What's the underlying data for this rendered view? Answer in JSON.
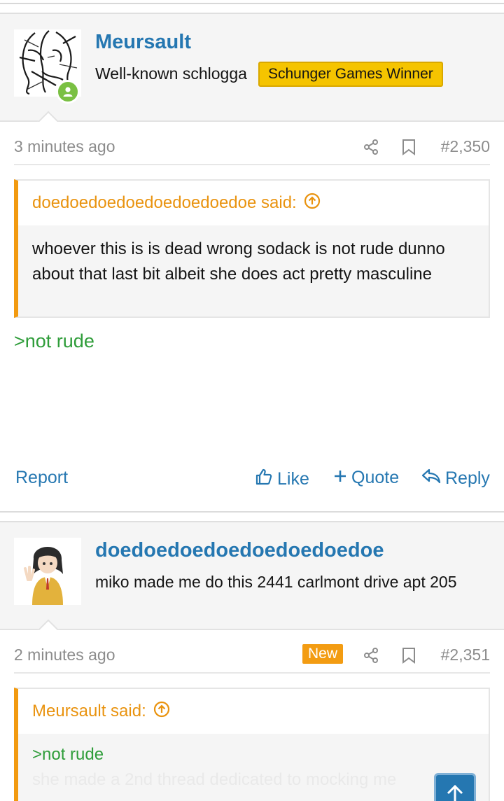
{
  "post1": {
    "username": "Meursault",
    "user_title": "Well-known schlogga",
    "banner": "Schunger Games Winner",
    "time": "3 minutes ago",
    "post_number": "#2,350",
    "quote_author": "doedoedoedoedoedoedoedoe said:",
    "quote_text": "whoever this is is dead wrong sodack is not rude dunno about that last bit albeit she does act pretty masculine",
    "reply_greentext": ">not rude",
    "actions": {
      "report": "Report",
      "like": "Like",
      "quote": "Quote",
      "reply": "Reply"
    }
  },
  "post2": {
    "username": "doedoedoedoedoedoedoedoe",
    "user_title": "miko made me do this 2441 carlmont drive apt 205",
    "time": "2 minutes ago",
    "new_badge": "New",
    "post_number": "#2,351",
    "quote_author": "Meursault said:",
    "quote_greentext": ">not rude",
    "quote_faded": "she made a 2nd thread dedicated to mocking me"
  },
  "colors": {
    "link": "#2577b1",
    "quote_accent": "#f29a10",
    "greentext": "#2f9d3a",
    "banner": "#f5c400",
    "online": "#7ac043"
  },
  "icons": [
    "share-icon",
    "bookmark-icon",
    "arrow-up-circle-icon",
    "thumbs-up-icon",
    "plus-icon",
    "reply-icon",
    "arrow-up-icon"
  ]
}
